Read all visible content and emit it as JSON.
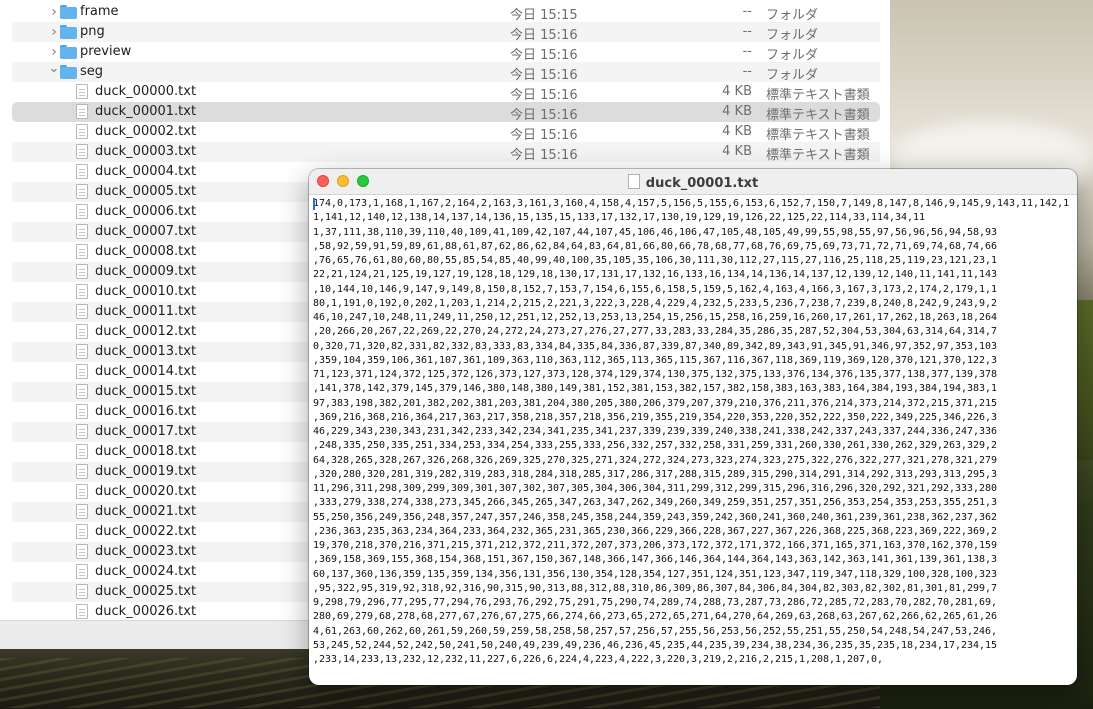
{
  "finder": {
    "folders": [
      {
        "name": "frame",
        "date": "今日 15:15",
        "size": "--",
        "kind": "フォルダ",
        "expanded": false
      },
      {
        "name": "png",
        "date": "今日 15:16",
        "size": "--",
        "kind": "フォルダ",
        "expanded": false
      },
      {
        "name": "preview",
        "date": "今日 15:16",
        "size": "--",
        "kind": "フォルダ",
        "expanded": false
      },
      {
        "name": "seg",
        "date": "今日 15:16",
        "size": "--",
        "kind": "フォルダ",
        "expanded": true
      }
    ],
    "files": [
      {
        "name": "duck_00000.txt",
        "date": "今日 15:16",
        "size": "4 KB",
        "kind": "標準テキスト書類"
      },
      {
        "name": "duck_00001.txt",
        "date": "今日 15:16",
        "size": "4 KB",
        "kind": "標準テキスト書類",
        "selected": true
      },
      {
        "name": "duck_00002.txt",
        "date": "今日 15:16",
        "size": "4 KB",
        "kind": "標準テキスト書類"
      },
      {
        "name": "duck_00003.txt",
        "date": "今日 15:16",
        "size": "4 KB",
        "kind": "標準テキスト書類"
      },
      {
        "name": "duck_00004.txt"
      },
      {
        "name": "duck_00005.txt"
      },
      {
        "name": "duck_00006.txt"
      },
      {
        "name": "duck_00007.txt"
      },
      {
        "name": "duck_00008.txt"
      },
      {
        "name": "duck_00009.txt"
      },
      {
        "name": "duck_00010.txt"
      },
      {
        "name": "duck_00011.txt"
      },
      {
        "name": "duck_00012.txt"
      },
      {
        "name": "duck_00013.txt"
      },
      {
        "name": "duck_00014.txt"
      },
      {
        "name": "duck_00015.txt"
      },
      {
        "name": "duck_00016.txt"
      },
      {
        "name": "duck_00017.txt"
      },
      {
        "name": "duck_00018.txt"
      },
      {
        "name": "duck_00019.txt"
      },
      {
        "name": "duck_00020.txt"
      },
      {
        "name": "duck_00021.txt"
      },
      {
        "name": "duck_00022.txt"
      },
      {
        "name": "duck_00023.txt"
      },
      {
        "name": "duck_00024.txt"
      },
      {
        "name": "duck_00025.txt"
      },
      {
        "name": "duck_00026.txt"
      }
    ]
  },
  "viewer": {
    "title": "duck_00001.txt",
    "content": "174,0,173,1,168,1,167,2,164,2,163,3,161,3,160,4,158,4,157,5,156,5,155,6,153,6,152,7,150,7,149,8,147,8,146,9,145,9,143,11,142,11,141,12,140,12,138,14,137,14,136,15,135,15,133,17,132,17,130,19,129,19,126,22,125,22,114,33,114,34,11\n1,37,111,38,110,39,110,40,109,41,109,42,107,44,107,45,106,46,106,47,105,48,105,49,99,55,98,55,97,56,96,56,94,58,93\n,58,92,59,91,59,89,61,88,61,87,62,86,62,84,64,83,64,81,66,80,66,78,68,77,68,76,69,75,69,73,71,72,71,69,74,68,74,66\n,76,65,76,61,80,60,80,55,85,54,85,40,99,40,100,35,105,35,106,30,111,30,112,27,115,27,116,25,118,25,119,23,121,23,1\n22,21,124,21,125,19,127,19,128,18,129,18,130,17,131,17,132,16,133,16,134,14,136,14,137,12,139,12,140,11,141,11,143\n,10,144,10,146,9,147,9,149,8,150,8,152,7,153,7,154,6,155,6,158,5,159,5,162,4,163,4,166,3,167,3,173,2,174,2,179,1,1\n80,1,191,0,192,0,202,1,203,1,214,2,215,2,221,3,222,3,228,4,229,4,232,5,233,5,236,7,238,7,239,8,240,8,242,9,243,9,2\n46,10,247,10,248,11,249,11,250,12,251,12,252,13,253,13,254,15,256,15,258,16,259,16,260,17,261,17,262,18,263,18,264\n,20,266,20,267,22,269,22,270,24,272,24,273,27,276,27,277,33,283,33,284,35,286,35,287,52,304,53,304,63,314,64,314,7\n0,320,71,320,82,331,82,332,83,333,83,334,84,335,84,336,87,339,87,340,89,342,89,343,91,345,91,346,97,352,97,353,103\n,359,104,359,106,361,107,361,109,363,110,363,112,365,113,365,115,367,116,367,118,369,119,369,120,370,121,370,122,3\n71,123,371,124,372,125,372,126,373,127,373,128,374,129,374,130,375,132,375,133,376,134,376,135,377,138,377,139,378\n,141,378,142,379,145,379,146,380,148,380,149,381,152,381,153,382,157,382,158,383,163,383,164,384,193,384,194,383,1\n97,383,198,382,201,382,202,381,203,381,204,380,205,380,206,379,207,379,210,376,211,376,214,373,214,372,215,371,215\n,369,216,368,216,364,217,363,217,358,218,357,218,356,219,355,219,354,220,353,220,352,222,350,222,349,225,346,226,3\n46,229,343,230,343,231,342,233,342,234,341,235,341,237,339,239,339,240,338,241,338,242,337,243,337,244,336,247,336\n,248,335,250,335,251,334,253,334,254,333,255,333,256,332,257,332,258,331,259,331,260,330,261,330,262,329,263,329,2\n64,328,265,328,267,326,268,326,269,325,270,325,271,324,272,324,273,323,274,323,275,322,276,322,277,321,278,321,279\n,320,280,320,281,319,282,319,283,318,284,318,285,317,286,317,288,315,289,315,290,314,291,314,292,313,293,313,295,3\n11,296,311,298,309,299,309,301,307,302,307,305,304,306,304,311,299,312,299,315,296,316,296,320,292,321,292,333,280\n,333,279,338,274,338,273,345,266,345,265,347,263,347,262,349,260,349,259,351,257,351,256,353,254,353,253,355,251,3\n55,250,356,249,356,248,357,247,357,246,358,245,358,244,359,243,359,242,360,241,360,240,361,239,361,238,362,237,362\n,236,363,235,363,234,364,233,364,232,365,231,365,230,366,229,366,228,367,227,367,226,368,225,368,223,369,222,369,2\n19,370,218,370,216,371,215,371,212,372,211,372,207,373,206,373,172,372,171,372,166,371,165,371,163,370,162,370,159\n,369,158,369,155,368,154,368,151,367,150,367,148,366,147,366,146,364,144,364,143,363,142,363,141,361,139,361,138,3\n60,137,360,136,359,135,359,134,356,131,356,130,354,128,354,127,351,124,351,123,347,119,347,118,329,100,328,100,323\n,95,322,95,319,92,318,92,316,90,315,90,313,88,312,88,310,86,309,86,307,84,306,84,304,82,303,82,302,81,301,81,299,7\n9,298,79,296,77,295,77,294,76,293,76,292,75,291,75,290,74,289,74,288,73,287,73,286,72,285,72,283,70,282,70,281,69,\n280,69,279,68,278,68,277,67,276,67,275,66,274,66,273,65,272,65,271,64,270,64,269,63,268,63,267,62,266,62,265,61,26\n4,61,263,60,262,60,261,59,260,59,259,58,258,58,257,57,256,57,255,56,253,56,252,55,251,55,250,54,248,54,247,53,246,\n53,245,52,244,52,242,50,241,50,240,49,239,49,236,46,236,45,235,44,235,39,234,38,234,36,235,35,235,18,234,17,234,15\n,233,14,233,13,232,12,232,11,227,6,226,6,224,4,223,4,222,3,220,3,219,2,216,2,215,1,208,1,207,0,"
  }
}
